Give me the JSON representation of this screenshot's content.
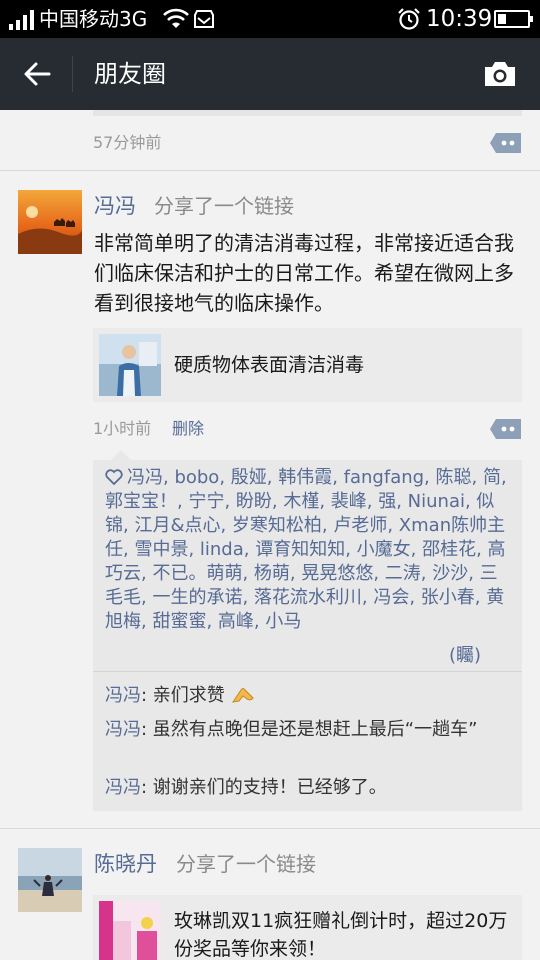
{
  "status_bar": {
    "carrier": "中国移动3G",
    "time": "10:39",
    "battery_level": 0.3
  },
  "titlebar": {
    "title": "朋友圈",
    "back_icon": "arrow-left-icon",
    "camera_icon": "camera-icon"
  },
  "prev_post": {
    "time": "57分钟前"
  },
  "post1": {
    "name": "冯冯",
    "share_label": "分享了一个链接",
    "text": "非常简单明了的清洁消毒过程，非常接近适合我们临床保洁和护士的日常工作。希望在微网上多看到很接地气的临床操作。",
    "link_title": "硬质物体表面清洁消毒",
    "time": "1小时前",
    "delete_label": "删除",
    "likes": "冯冯, bobo, 殷娅, 韩伟霞, fangfang, 陈聪, 简, 郭宝宝！, 宁宁, 盼盼, 木槿, 裴峰, 强, Niunai, 似锦, 江月&点心, 岁寒知松柏, 卢老师, Xman陈帅主任, 雪中景, linda, 谭育知知知, 小魔女, 邵桂花, 高巧云, 不已。萌萌, 杨萌, 晃晃悠悠, 二涛, 沙沙, 三毛毛, 一生的承诺, 落花流水利川, 冯会, 张小春, 黄旭梅, 甜蜜蜜, 高峰, 小马",
    "likes_more": "(矚)",
    "comments": [
      {
        "name": "冯冯",
        "text": "亲们求赞"
      },
      {
        "name": "冯冯",
        "text": "虽然有点晚但是还是想赶上最后“一趟车”"
      },
      {
        "name": "冯冯",
        "text": "谢谢亲们的支持！已经够了。"
      }
    ]
  },
  "post2": {
    "name": "陈晓丹",
    "share_label": "分享了一个链接",
    "link_title": "玫琳凯双11疯狂赠礼倒计时，超过20万份奖品等你来领！"
  }
}
